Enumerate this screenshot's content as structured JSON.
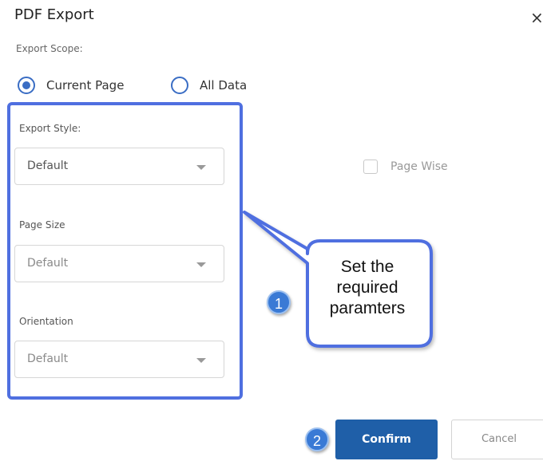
{
  "dialog": {
    "title": "PDF Export",
    "close_icon": "close-icon"
  },
  "scope": {
    "label": "Export Scope:",
    "options": [
      {
        "label": "Current Page",
        "selected": true
      },
      {
        "label": "All Data",
        "selected": false
      }
    ]
  },
  "fields": {
    "export_style": {
      "label": "Export Style:",
      "value": "Default"
    },
    "page_size": {
      "label": "Page Size",
      "value": "Default"
    },
    "orientation": {
      "label": "Orientation",
      "value": "Default"
    }
  },
  "page_wise": {
    "label": "Page Wise",
    "checked": false
  },
  "callout": {
    "lines": [
      "Set the",
      "required",
      "paramters"
    ],
    "step1": "1",
    "step2": "2"
  },
  "buttons": {
    "confirm": "Confirm",
    "cancel": "Cancel"
  },
  "colors": {
    "accent": "#3a6dc4",
    "highlight_border": "#4f6fe0",
    "confirm_bg": "#1f5fa8",
    "badge": "#3a7ad5"
  }
}
